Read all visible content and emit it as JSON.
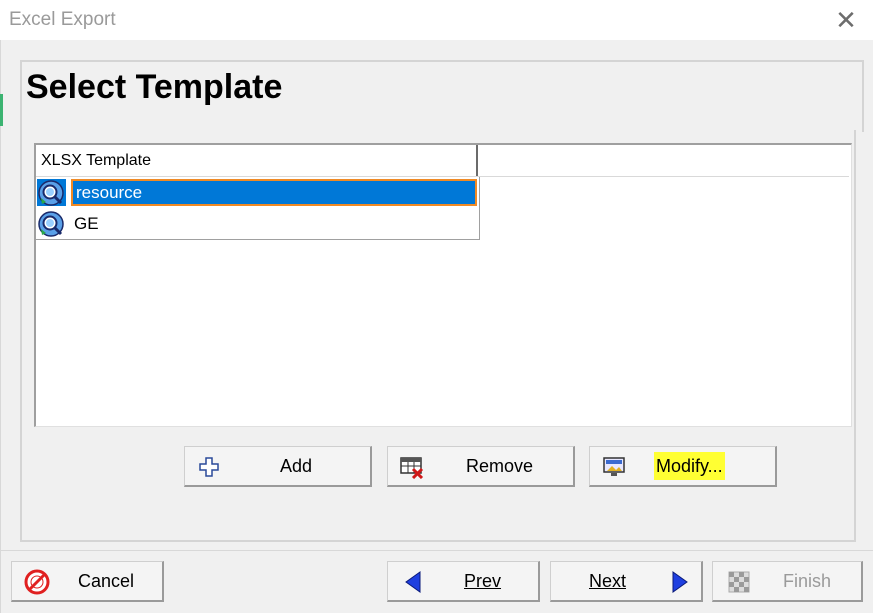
{
  "window": {
    "title": "Excel Export",
    "close_label": "✕"
  },
  "page": {
    "heading": "Select Template"
  },
  "list": {
    "column_header": "XLSX Template",
    "items": [
      {
        "label": "resource",
        "selected": true,
        "icon": "template-search-icon"
      },
      {
        "label": "GE",
        "selected": false,
        "icon": "template-search-icon"
      }
    ]
  },
  "actions": {
    "add_label": "Add",
    "remove_label": "Remove",
    "modify_label": "Modify..."
  },
  "footer": {
    "cancel_label": "Cancel",
    "prev_label": "Prev",
    "next_label": "Next",
    "finish_label": "Finish"
  },
  "colors": {
    "selection": "#0078d7",
    "focus_border": "#f08a24",
    "highlight": "#ffff33",
    "arrow": "#1e3fe0",
    "cancel_red": "#e02020"
  }
}
